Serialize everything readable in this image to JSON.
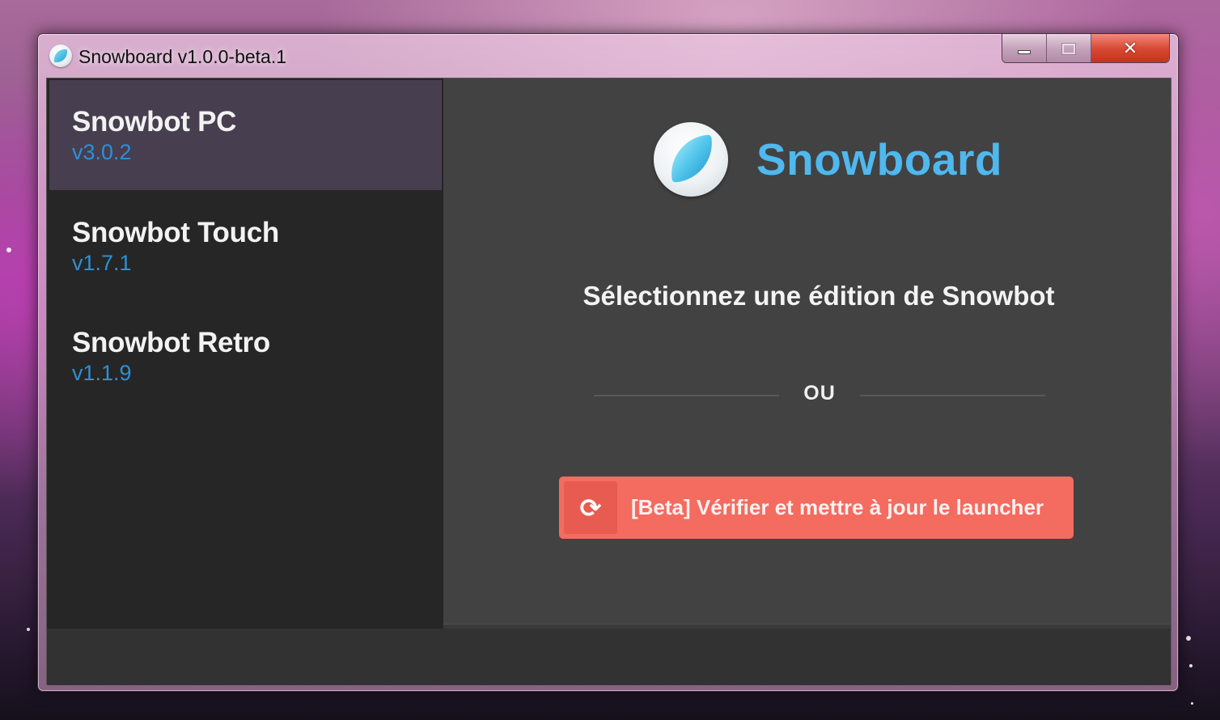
{
  "window": {
    "title": "Snowboard v1.0.0-beta.1",
    "controls": {
      "minimize_icon": "minimize-icon",
      "maximize_icon": "maximize-icon",
      "close_icon": "close-icon",
      "close_glyph": "✕"
    }
  },
  "sidebar": {
    "items": [
      {
        "name": "Snowbot PC",
        "version": "v3.0.2",
        "active": true
      },
      {
        "name": "Snowbot Touch",
        "version": "v1.7.1",
        "active": false
      },
      {
        "name": "Snowbot Retro",
        "version": "v1.1.9",
        "active": false
      }
    ]
  },
  "main": {
    "brand": "Snowboard",
    "subtitle": "Sélectionnez une édition de Snowbot",
    "separator": "OU",
    "update_button": {
      "label": "[Beta] Vérifier et mettre à jour le launcher",
      "icon": "refresh-icon",
      "icon_glyph": "⟳"
    }
  },
  "colors": {
    "accent_blue": "#4fb8ee",
    "version_blue": "#2e8fd6",
    "button_red": "#f46b5f",
    "active_item": "#473e4f"
  }
}
